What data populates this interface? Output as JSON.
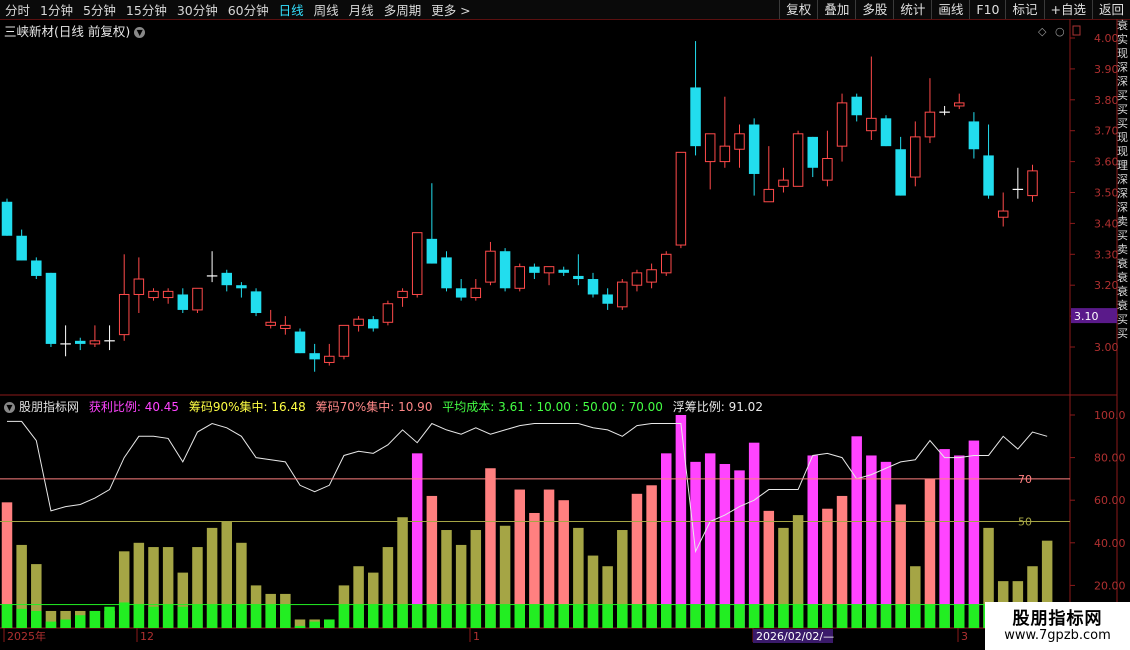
{
  "toolbar": {
    "periods": [
      "分时",
      "1分钟",
      "5分钟",
      "15分钟",
      "30分钟",
      "60分钟",
      "日线",
      "周线",
      "月线",
      "多周期",
      "更多 >"
    ],
    "active_period": "日线",
    "tools": [
      "复权",
      "叠加",
      "多股",
      "统计",
      "画线",
      "F10",
      "标记",
      "+自选",
      "返回"
    ]
  },
  "main_panel": {
    "title": "三峡新材(日线 前复权)",
    "price_axis_labels": [
      "4.00",
      "3.90",
      "3.80",
      "3.70",
      "3.60",
      "3.50",
      "3.40",
      "3.30",
      "3.20",
      "3.10",
      "3.00"
    ],
    "current_price_tag": "3.10",
    "up_color": "#ff4a4a",
    "down_color": "#22ddee"
  },
  "indicator_panel": {
    "name": "股朋指标网",
    "legend": [
      {
        "label": "获利比例: 40.45",
        "color": "#ff44ff"
      },
      {
        "label": "筹码90%集中: 16.48",
        "color": "#ffff44"
      },
      {
        "label": "筹码70%集中: 10.90",
        "color": "#ff8888"
      },
      {
        "label": "平均成本: 3.61 : 10.00 : 50.00 : 70.00",
        "color": "#44ff44"
      },
      {
        "label": "浮筹比例: 91.02",
        "color": "#e8e8e8"
      }
    ],
    "axis_labels": [
      "100.0",
      "80.00",
      "60.00",
      "40.00",
      "20.00"
    ],
    "ref_line_labels": [
      "70",
      "50"
    ]
  },
  "time_axis": {
    "labels": [
      "2025年",
      "12",
      "1",
      "2026/02/02/—",
      "3"
    ]
  },
  "right_strip_text": [
    "衰",
    "实",
    "现",
    "深",
    "深",
    "买",
    "买",
    "买",
    "现",
    "现",
    "理",
    "深",
    "深",
    "深",
    "卖",
    "买",
    "卖",
    "衰",
    "衰",
    "衰",
    "衰",
    "买",
    "买"
  ],
  "watermark": {
    "name": "股朋指标网",
    "url": "www.7gpzb.com"
  },
  "chart_data": [
    {
      "type": "candlestick",
      "title": "三峡新材(日线 前复权)",
      "ylim": [
        2.9,
        4.05
      ],
      "candles": [
        {
          "o": 3.47,
          "h": 3.48,
          "l": 3.36,
          "c": 3.36
        },
        {
          "o": 3.36,
          "h": 3.38,
          "l": 3.28,
          "c": 3.28
        },
        {
          "o": 3.28,
          "h": 3.29,
          "l": 3.22,
          "c": 3.23
        },
        {
          "o": 3.24,
          "h": 3.24,
          "l": 3.0,
          "c": 3.01
        },
        {
          "o": 3.01,
          "h": 3.07,
          "l": 2.97,
          "c": 3.01
        },
        {
          "o": 3.02,
          "h": 3.03,
          "l": 2.99,
          "c": 3.01
        },
        {
          "o": 3.01,
          "h": 3.07,
          "l": 3.0,
          "c": 3.02
        },
        {
          "o": 3.02,
          "h": 3.07,
          "l": 2.99,
          "c": 3.02
        },
        {
          "o": 3.04,
          "h": 3.3,
          "l": 3.02,
          "c": 3.17
        },
        {
          "o": 3.17,
          "h": 3.29,
          "l": 3.11,
          "c": 3.22
        },
        {
          "o": 3.16,
          "h": 3.19,
          "l": 3.15,
          "c": 3.18
        },
        {
          "o": 3.16,
          "h": 3.19,
          "l": 3.14,
          "c": 3.18
        },
        {
          "o": 3.17,
          "h": 3.19,
          "l": 3.11,
          "c": 3.12
        },
        {
          "o": 3.12,
          "h": 3.19,
          "l": 3.11,
          "c": 3.19
        },
        {
          "o": 3.23,
          "h": 3.31,
          "l": 3.21,
          "c": 3.23
        },
        {
          "o": 3.24,
          "h": 3.25,
          "l": 3.18,
          "c": 3.2
        },
        {
          "o": 3.2,
          "h": 3.21,
          "l": 3.16,
          "c": 3.19
        },
        {
          "o": 3.18,
          "h": 3.19,
          "l": 3.1,
          "c": 3.11
        },
        {
          "o": 3.07,
          "h": 3.12,
          "l": 3.06,
          "c": 3.08
        },
        {
          "o": 3.06,
          "h": 3.1,
          "l": 3.04,
          "c": 3.07
        },
        {
          "o": 3.05,
          "h": 3.06,
          "l": 2.98,
          "c": 2.98
        },
        {
          "o": 2.98,
          "h": 3.01,
          "l": 2.92,
          "c": 2.96
        },
        {
          "o": 2.95,
          "h": 3.01,
          "l": 2.94,
          "c": 2.97
        },
        {
          "o": 2.97,
          "h": 3.07,
          "l": 2.96,
          "c": 3.07
        },
        {
          "o": 3.07,
          "h": 3.1,
          "l": 3.05,
          "c": 3.09
        },
        {
          "o": 3.09,
          "h": 3.1,
          "l": 3.05,
          "c": 3.06
        },
        {
          "o": 3.08,
          "h": 3.15,
          "l": 3.07,
          "c": 3.14
        },
        {
          "o": 3.16,
          "h": 3.19,
          "l": 3.13,
          "c": 3.18
        },
        {
          "o": 3.17,
          "h": 3.37,
          "l": 3.16,
          "c": 3.37
        },
        {
          "o": 3.35,
          "h": 3.53,
          "l": 3.27,
          "c": 3.27
        },
        {
          "o": 3.29,
          "h": 3.31,
          "l": 3.18,
          "c": 3.19
        },
        {
          "o": 3.19,
          "h": 3.22,
          "l": 3.15,
          "c": 3.16
        },
        {
          "o": 3.16,
          "h": 3.22,
          "l": 3.15,
          "c": 3.19
        },
        {
          "o": 3.21,
          "h": 3.34,
          "l": 3.2,
          "c": 3.31
        },
        {
          "o": 3.31,
          "h": 3.32,
          "l": 3.18,
          "c": 3.19
        },
        {
          "o": 3.19,
          "h": 3.27,
          "l": 3.18,
          "c": 3.26
        },
        {
          "o": 3.26,
          "h": 3.27,
          "l": 3.22,
          "c": 3.24
        },
        {
          "o": 3.24,
          "h": 3.26,
          "l": 3.2,
          "c": 3.26
        },
        {
          "o": 3.25,
          "h": 3.26,
          "l": 3.23,
          "c": 3.24
        },
        {
          "o": 3.23,
          "h": 3.3,
          "l": 3.2,
          "c": 3.22
        },
        {
          "o": 3.22,
          "h": 3.24,
          "l": 3.16,
          "c": 3.17
        },
        {
          "o": 3.17,
          "h": 3.19,
          "l": 3.12,
          "c": 3.14
        },
        {
          "o": 3.13,
          "h": 3.22,
          "l": 3.12,
          "c": 3.21
        },
        {
          "o": 3.2,
          "h": 3.25,
          "l": 3.18,
          "c": 3.24
        },
        {
          "o": 3.21,
          "h": 3.27,
          "l": 3.19,
          "c": 3.25
        },
        {
          "o": 3.24,
          "h": 3.31,
          "l": 3.23,
          "c": 3.3
        },
        {
          "o": 3.33,
          "h": 3.63,
          "l": 3.32,
          "c": 3.63
        },
        {
          "o": 3.84,
          "h": 3.99,
          "l": 3.62,
          "c": 3.65
        },
        {
          "o": 3.6,
          "h": 3.69,
          "l": 3.51,
          "c": 3.69
        },
        {
          "o": 3.6,
          "h": 3.81,
          "l": 3.58,
          "c": 3.65
        },
        {
          "o": 3.64,
          "h": 3.72,
          "l": 3.58,
          "c": 3.69
        },
        {
          "o": 3.72,
          "h": 3.74,
          "l": 3.49,
          "c": 3.56
        },
        {
          "o": 3.47,
          "h": 3.65,
          "l": 3.47,
          "c": 3.51
        },
        {
          "o": 3.52,
          "h": 3.58,
          "l": 3.5,
          "c": 3.54
        },
        {
          "o": 3.52,
          "h": 3.7,
          "l": 3.52,
          "c": 3.69
        },
        {
          "o": 3.68,
          "h": 3.68,
          "l": 3.55,
          "c": 3.58
        },
        {
          "o": 3.54,
          "h": 3.7,
          "l": 3.52,
          "c": 3.61
        },
        {
          "o": 3.65,
          "h": 3.82,
          "l": 3.6,
          "c": 3.79
        },
        {
          "o": 3.81,
          "h": 3.82,
          "l": 3.73,
          "c": 3.75
        },
        {
          "o": 3.7,
          "h": 3.94,
          "l": 3.67,
          "c": 3.74
        },
        {
          "o": 3.74,
          "h": 3.75,
          "l": 3.65,
          "c": 3.65
        },
        {
          "o": 3.64,
          "h": 3.68,
          "l": 3.49,
          "c": 3.49
        },
        {
          "o": 3.55,
          "h": 3.73,
          "l": 3.52,
          "c": 3.68
        },
        {
          "o": 3.68,
          "h": 3.87,
          "l": 3.66,
          "c": 3.76
        },
        {
          "o": 3.76,
          "h": 3.78,
          "l": 3.75,
          "c": 3.76
        },
        {
          "o": 3.78,
          "h": 3.82,
          "l": 3.77,
          "c": 3.79
        },
        {
          "o": 3.73,
          "h": 3.76,
          "l": 3.61,
          "c": 3.64
        },
        {
          "o": 3.62,
          "h": 3.72,
          "l": 3.48,
          "c": 3.49
        },
        {
          "o": 3.42,
          "h": 3.5,
          "l": 3.39,
          "c": 3.44
        },
        {
          "o": 3.51,
          "h": 3.58,
          "l": 3.48,
          "c": 3.51
        },
        {
          "o": 3.49,
          "h": 3.59,
          "l": 3.47,
          "c": 3.57
        }
      ]
    },
    {
      "type": "bar",
      "title": "股朋指标网",
      "ylim": [
        0,
        105
      ],
      "series": [
        {
          "name": "获利比例",
          "color": "#ff44ff"
        },
        {
          "name": "浮筹比例",
          "color": "#e8e8e8"
        }
      ],
      "bars": [
        59,
        39,
        30,
        8,
        8,
        8,
        8,
        8,
        36,
        40,
        38,
        38,
        26,
        38,
        47,
        50,
        40,
        20,
        16,
        16,
        4,
        4,
        4,
        20,
        29,
        26,
        38,
        52,
        82,
        62,
        46,
        39,
        46,
        75,
        48,
        65,
        54,
        65,
        60,
        47,
        34,
        29,
        46,
        63,
        67,
        82,
        100,
        78,
        82,
        77,
        74,
        87,
        55,
        47,
        53,
        81,
        56,
        62,
        90,
        81,
        78,
        58,
        29,
        70,
        84,
        81,
        88,
        47,
        22,
        22,
        29,
        41
      ],
      "bar_colors": [
        "#ff8080",
        "#a5a545",
        "#a5a545",
        "#a5a545",
        "#a5a545",
        "#a5a545",
        "#a5a545",
        "#a5a545",
        "#a5a545",
        "#a5a545",
        "#a5a545",
        "#a5a545",
        "#a5a545",
        "#a5a545",
        "#a5a545",
        "#a5a545",
        "#a5a545",
        "#a5a545",
        "#a5a545",
        "#a5a545",
        "#a5a545",
        "#a5a545",
        "#a5a545",
        "#a5a545",
        "#a5a545",
        "#a5a545",
        "#a5a545",
        "#a5a545",
        "#ff44ff",
        "#ff8080",
        "#a5a545",
        "#a5a545",
        "#a5a545",
        "#ff8080",
        "#a5a545",
        "#ff8080",
        "#ff8080",
        "#ff8080",
        "#ff8080",
        "#a5a545",
        "#a5a545",
        "#a5a545",
        "#a5a545",
        "#ff8080",
        "#ff8080",
        "#ff44ff",
        "#ff44ff",
        "#ff44ff",
        "#ff44ff",
        "#ff44ff",
        "#ff44ff",
        "#ff44ff",
        "#ff8080",
        "#a5a545",
        "#a5a545",
        "#ff44ff",
        "#ff8080",
        "#ff8080",
        "#ff44ff",
        "#ff44ff",
        "#ff44ff",
        "#ff8080",
        "#a5a545",
        "#ff8080",
        "#ff44ff",
        "#ff44ff",
        "#ff44ff",
        "#a5a545",
        "#a5a545",
        "#a5a545",
        "#a5a545",
        "#a5a545"
      ],
      "green_bars": [
        11,
        9,
        8,
        3,
        4,
        6,
        8,
        10,
        12,
        11,
        10,
        11,
        10,
        11,
        11,
        11,
        11,
        11,
        11,
        11,
        1,
        3,
        4,
        11,
        11,
        11,
        11,
        11,
        11,
        11,
        11,
        11,
        11,
        11,
        11,
        11,
        11,
        11,
        11,
        11,
        11,
        11,
        11,
        11,
        11,
        11,
        11,
        11,
        11,
        11,
        11,
        11,
        11,
        11,
        11,
        11,
        11,
        11,
        11,
        11,
        11,
        11,
        11,
        11,
        11,
        11,
        11,
        11,
        11,
        11,
        11,
        11
      ],
      "line": [
        97,
        97,
        88,
        55,
        57,
        58,
        61,
        65,
        80,
        90,
        90,
        89,
        78,
        92,
        96,
        94,
        90,
        80,
        79,
        78,
        67,
        64,
        67,
        81,
        83,
        82,
        86,
        93,
        87,
        96,
        93,
        91,
        94,
        91,
        93,
        95,
        96,
        96,
        96,
        96,
        94,
        93,
        90,
        95,
        96,
        96,
        96,
        36,
        50,
        53,
        57,
        60,
        65,
        65,
        65,
        81,
        82,
        80,
        70,
        72,
        75,
        78,
        79,
        88,
        80,
        80,
        81,
        81,
        90,
        84,
        92,
        90
      ],
      "ref_lines": [
        70,
        50
      ]
    }
  ]
}
